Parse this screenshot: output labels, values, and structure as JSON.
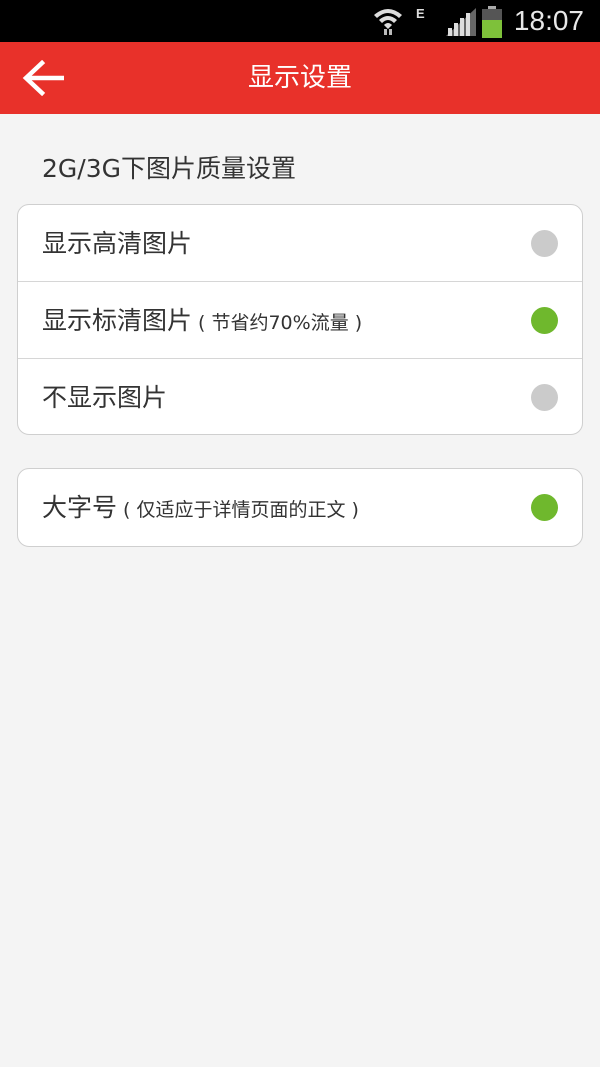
{
  "status_bar": {
    "time": "18:07",
    "network_type": "E",
    "icons": [
      "wifi-icon",
      "signal-icon",
      "battery-icon"
    ]
  },
  "app_bar": {
    "title": "显示设置",
    "back_icon": "arrow-left-icon",
    "color": "#e8312a"
  },
  "section": {
    "label": "2G/3G下图片质量设置"
  },
  "quality_options": [
    {
      "label": "显示高清图片",
      "note": "",
      "selected": false
    },
    {
      "label": "显示标清图片",
      "note": "( 节省约70%流量 )",
      "selected": true
    },
    {
      "label": "不显示图片",
      "note": "",
      "selected": false
    }
  ],
  "font_option": {
    "label": "大字号",
    "note": "( 仅适应于详情页面的正文 )",
    "enabled": true
  },
  "colors": {
    "selected": "#6fb82d",
    "unselected": "#cbcbcb",
    "background": "#f4f4f4"
  }
}
